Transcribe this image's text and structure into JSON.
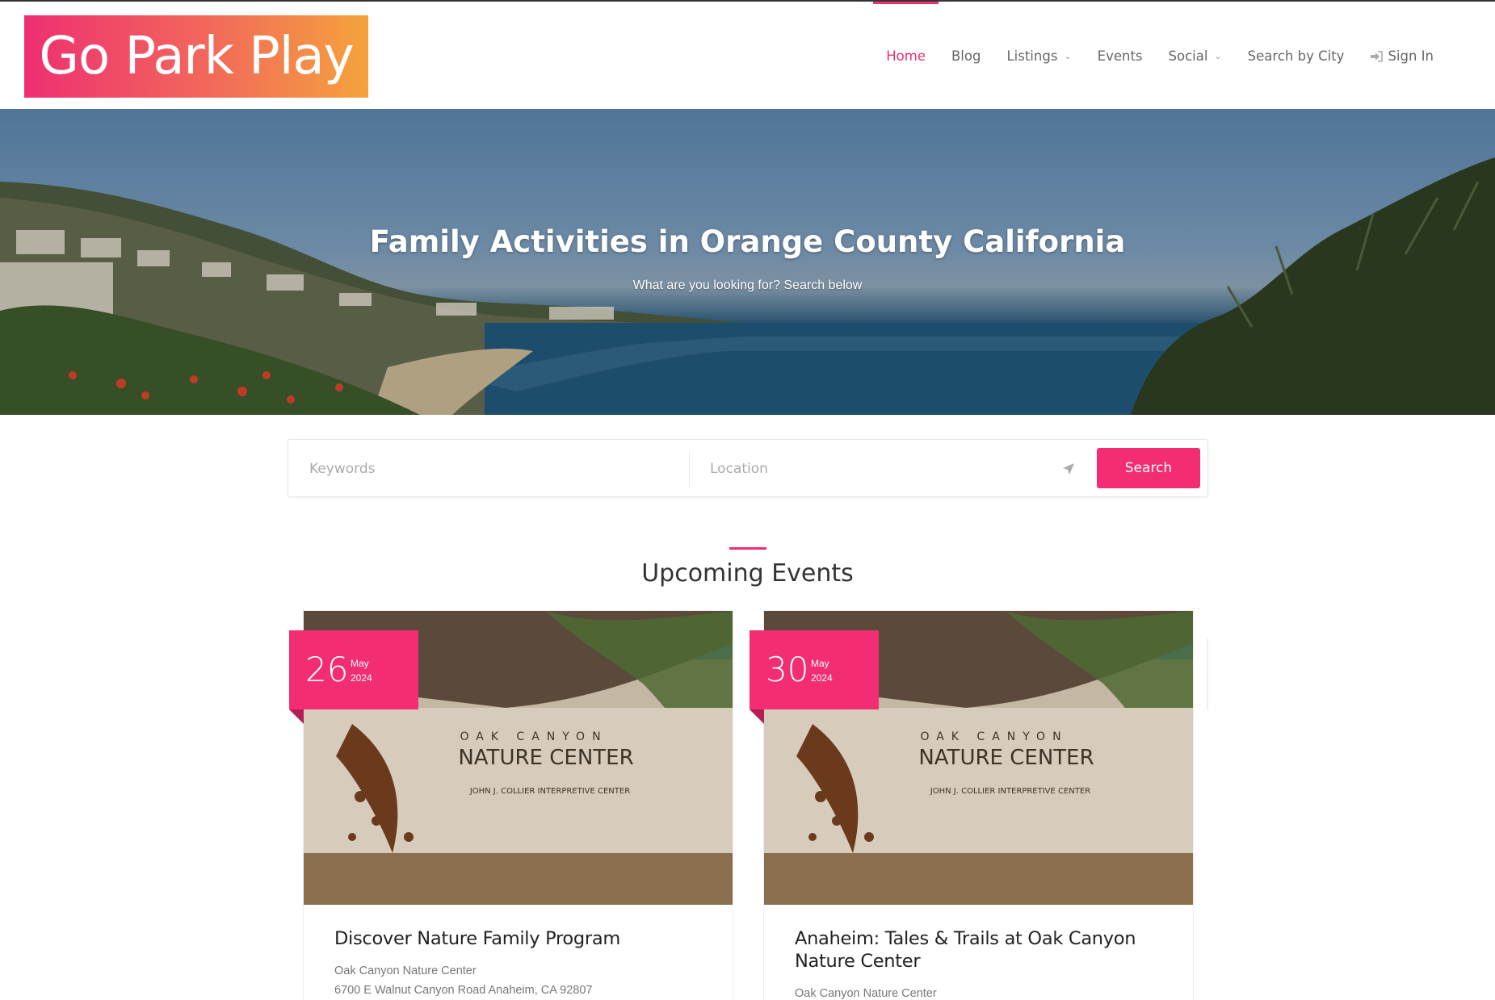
{
  "brand": {
    "logo_text": "Go Park Play"
  },
  "nav": {
    "items": [
      {
        "label": "Home",
        "active": true,
        "dropdown": false
      },
      {
        "label": "Blog",
        "active": false,
        "dropdown": false
      },
      {
        "label": "Listings",
        "active": false,
        "dropdown": true
      },
      {
        "label": "Events",
        "active": false,
        "dropdown": false
      },
      {
        "label": "Social",
        "active": false,
        "dropdown": true
      },
      {
        "label": "Search by City",
        "active": false,
        "dropdown": false
      }
    ],
    "signin": {
      "label": "Sign In",
      "icon": "sign-in-icon"
    }
  },
  "hero": {
    "title": "Family Activities in Orange County California",
    "subtitle": "What are you looking for? Search below"
  },
  "search": {
    "keywords_placeholder": "Keywords",
    "location_placeholder": "Location",
    "location_icon": "location-arrow-icon",
    "button_label": "Search"
  },
  "section": {
    "title": "Upcoming Events"
  },
  "events": [
    {
      "day": "26",
      "month": "May",
      "year": "2024",
      "title": "Discover Nature Family Program",
      "venue": "Oak Canyon Nature Center",
      "address": "6700 E Walnut Canyon Road Anaheim, CA 92807",
      "image_sign": {
        "line1": "OAK CANYON",
        "line2": "NATURE CENTER",
        "line3": "JOHN J. COLLIER INTERPRETIVE CENTER"
      }
    },
    {
      "day": "30",
      "month": "May",
      "year": "2024",
      "title": "Anaheim: Tales & Trails at Oak Canyon Nature Center",
      "venue": "Oak Canyon Nature Center",
      "address": "",
      "image_sign": {
        "line1": "OAK CANYON",
        "line2": "NATURE CENTER",
        "line3": "JOHN J. COLLIER INTERPRETIVE CENTER"
      }
    }
  ],
  "colors": {
    "accent": "#f22d73",
    "logo_gradient_start": "#ee2f72",
    "logo_gradient_end": "#f4a33c"
  }
}
